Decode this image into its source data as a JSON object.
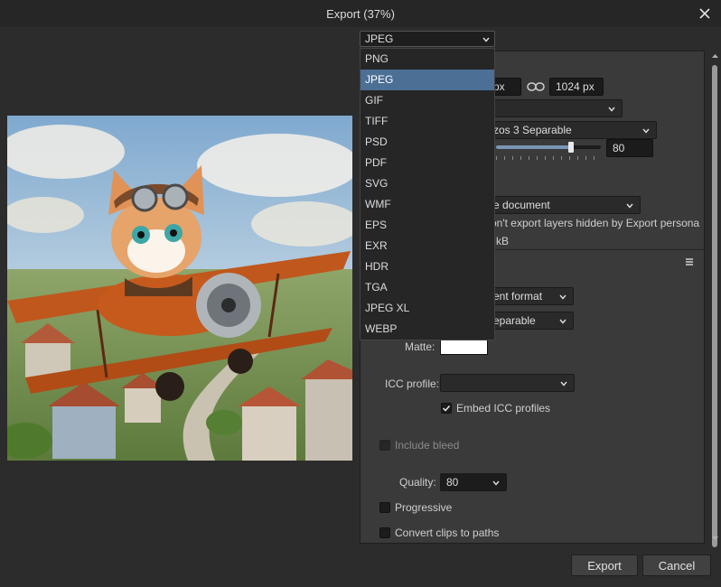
{
  "window": {
    "title": "Export (37%)"
  },
  "format": {
    "selected": "JPEG",
    "options": [
      "PNG",
      "JPEG",
      "GIF",
      "TIFF",
      "PSD",
      "PDF",
      "SVG",
      "WMF",
      "EPS",
      "EXR",
      "HDR",
      "TGA",
      "JPEG XL",
      "WEBP"
    ],
    "selected_index": 1
  },
  "settings": {
    "width_value": "px",
    "height_value": "1024 px",
    "resample_value": "zos 3 Separable",
    "slider_value": "80",
    "slider_fraction": 0.8,
    "area_value": "e document",
    "hidden_layers_text": "on't export layers hidden by Export persona",
    "size_estimate": "kB",
    "pixel_format_value": "ent format",
    "resampler_value": "eparable",
    "matte_label": "Matte:",
    "icc_label": "ICC profile:",
    "icc_value": "",
    "embed_icc_label": "Embed ICC profiles",
    "embed_icc_checked": true,
    "include_bleed_label": "Include bleed",
    "quality_label": "Quality:",
    "quality_value": "80",
    "progressive_label": "Progressive",
    "convert_clips_label": "Convert clips to paths"
  },
  "buttons": {
    "export": "Export",
    "cancel": "Cancel"
  },
  "colors": {
    "accent": "#4c6f96",
    "background": "#2c2c2c",
    "panel": "#3a3a3a"
  },
  "icons": {
    "close": "close-icon",
    "link": "link-icon",
    "chevron": "chevron-down-icon",
    "menu": "hamburger-menu-icon",
    "check": "check-icon"
  }
}
